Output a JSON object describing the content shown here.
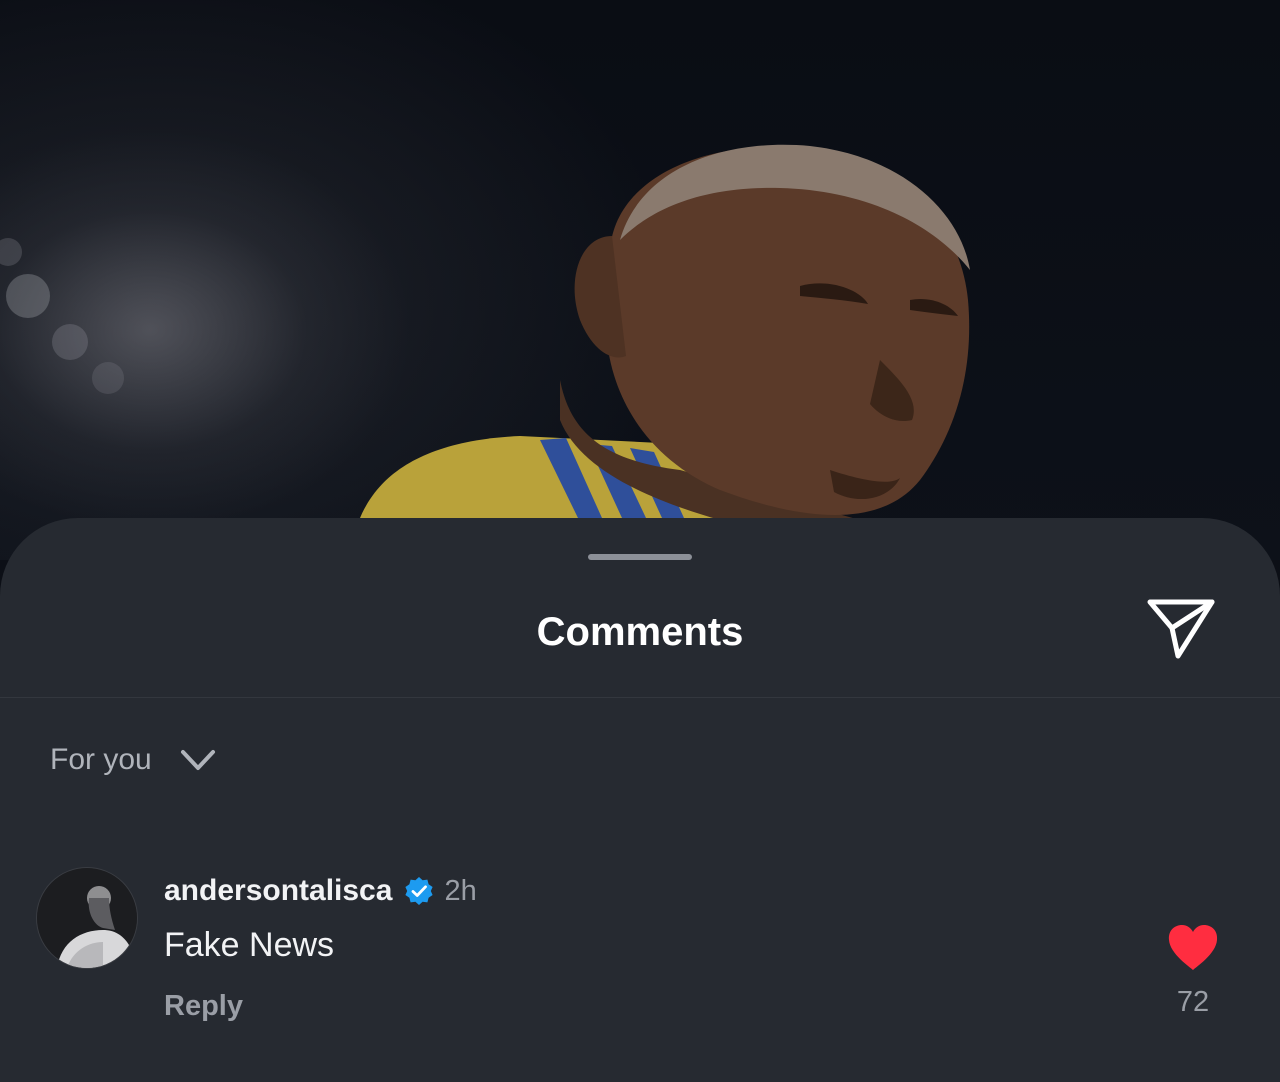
{
  "sheet": {
    "title": "Comments",
    "share_icon": "paper-plane-icon",
    "sort_label": "For you",
    "sort_icon": "chevron-down-icon"
  },
  "comments": [
    {
      "username": "andersontalisca",
      "verified": true,
      "time": "2h",
      "text": "Fake News",
      "reply_label": "Reply",
      "likes": "72",
      "liked": true
    }
  ],
  "colors": {
    "sheet_bg": "#262a31",
    "like_red": "#ff2d40",
    "verified_blue": "#1d9bf0",
    "muted_text": "#9a9ea6"
  }
}
